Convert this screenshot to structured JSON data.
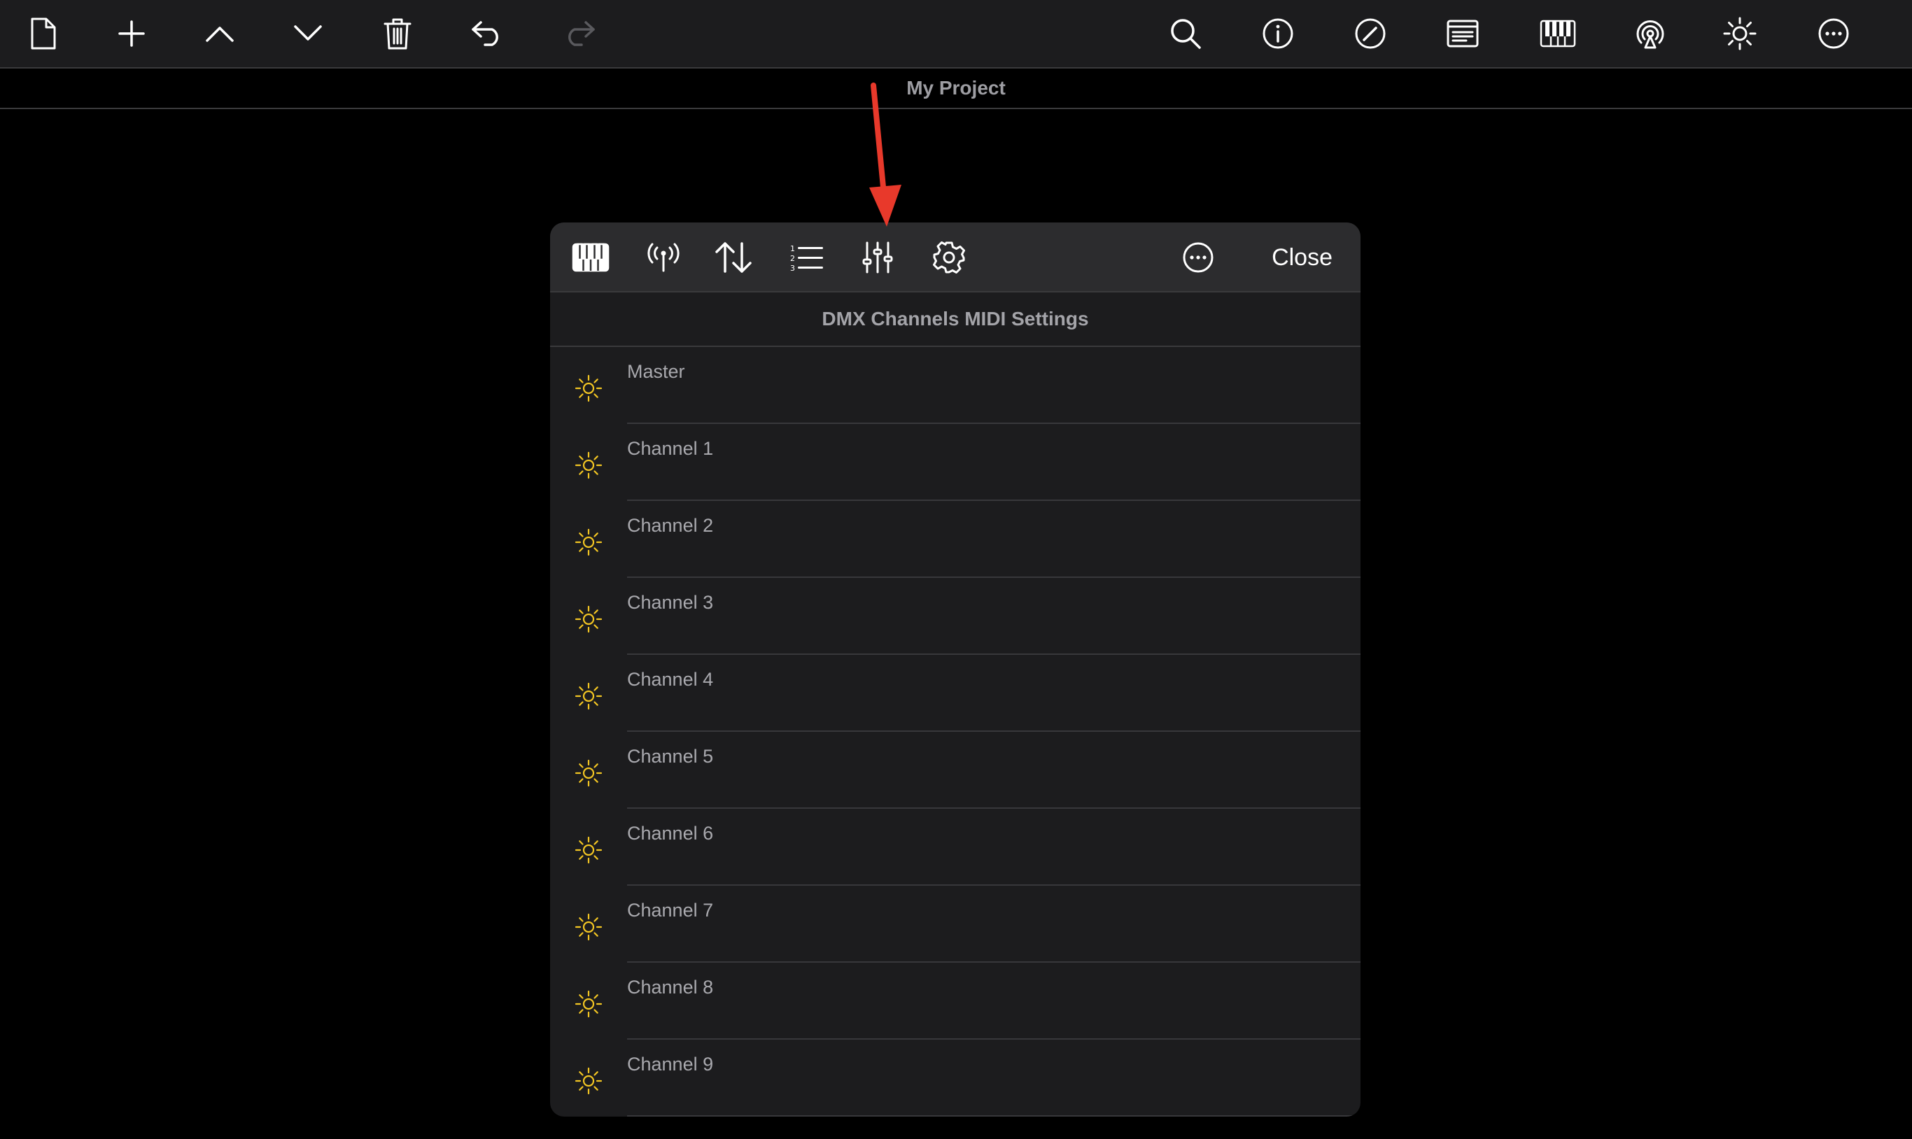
{
  "toolbar": {
    "left_icons": [
      "new-document-icon",
      "plus-icon",
      "chevron-up-icon",
      "chevron-down-icon",
      "trash-icon",
      "undo-icon",
      "redo-icon"
    ],
    "right_icons": [
      "search-icon",
      "info-icon",
      "edit-circle-icon",
      "document-text-icon",
      "piano-keys-icon",
      "broadcast-icon",
      "brightness-icon",
      "more-icon"
    ]
  },
  "project": {
    "title": "My Project"
  },
  "panel": {
    "toolbar_icons": [
      "piano-keys-icon",
      "antenna-icon",
      "sort-arrows-icon",
      "numbered-list-icon",
      "sliders-icon",
      "gear-icon"
    ],
    "more_icon": "more-circle-icon",
    "close_label": "Close",
    "header": "DMX Channels MIDI Settings",
    "rows": [
      {
        "label": "Master"
      },
      {
        "label": "Channel 1"
      },
      {
        "label": "Channel 2"
      },
      {
        "label": "Channel 3"
      },
      {
        "label": "Channel 4"
      },
      {
        "label": "Channel 5"
      },
      {
        "label": "Channel 6"
      },
      {
        "label": "Channel 7"
      },
      {
        "label": "Channel 8"
      },
      {
        "label": "Channel 9"
      }
    ]
  },
  "colors": {
    "accent_yellow": "#f3c623",
    "annotation_arrow": "#e8392b",
    "panel_bg": "#1c1c1e",
    "toolbar_bg": "#2c2c2e"
  }
}
